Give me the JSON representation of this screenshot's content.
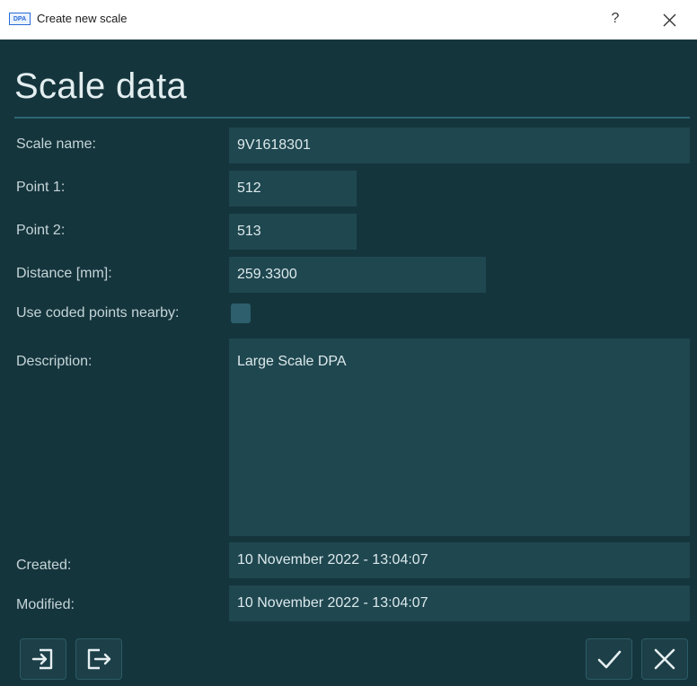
{
  "window": {
    "title": "Create new scale",
    "app_icon_text": "DPA",
    "help_label": "?"
  },
  "heading": "Scale data",
  "form": {
    "scale_name": {
      "label": "Scale name:",
      "value": "9V1618301"
    },
    "point1": {
      "label": "Point 1:",
      "value": "512"
    },
    "point2": {
      "label": "Point 2:",
      "value": "513"
    },
    "distance": {
      "label": "Distance [mm]:",
      "value": "259.3300"
    },
    "coded_points": {
      "label": "Use coded points nearby:",
      "checked": false
    },
    "description": {
      "label": "Description:",
      "value": "Large Scale DPA"
    },
    "created": {
      "label": "Created:",
      "value": "10 November 2022 - 13:04:07"
    },
    "modified": {
      "label": "Modified:",
      "value": "10 November 2022 - 13:04:07"
    }
  },
  "footer": {
    "icons": [
      "import-icon",
      "export-icon",
      "check-icon",
      "close-icon"
    ]
  },
  "colors": {
    "background": "#15353d",
    "field": "#1f4750",
    "accent": "#2c6873"
  }
}
